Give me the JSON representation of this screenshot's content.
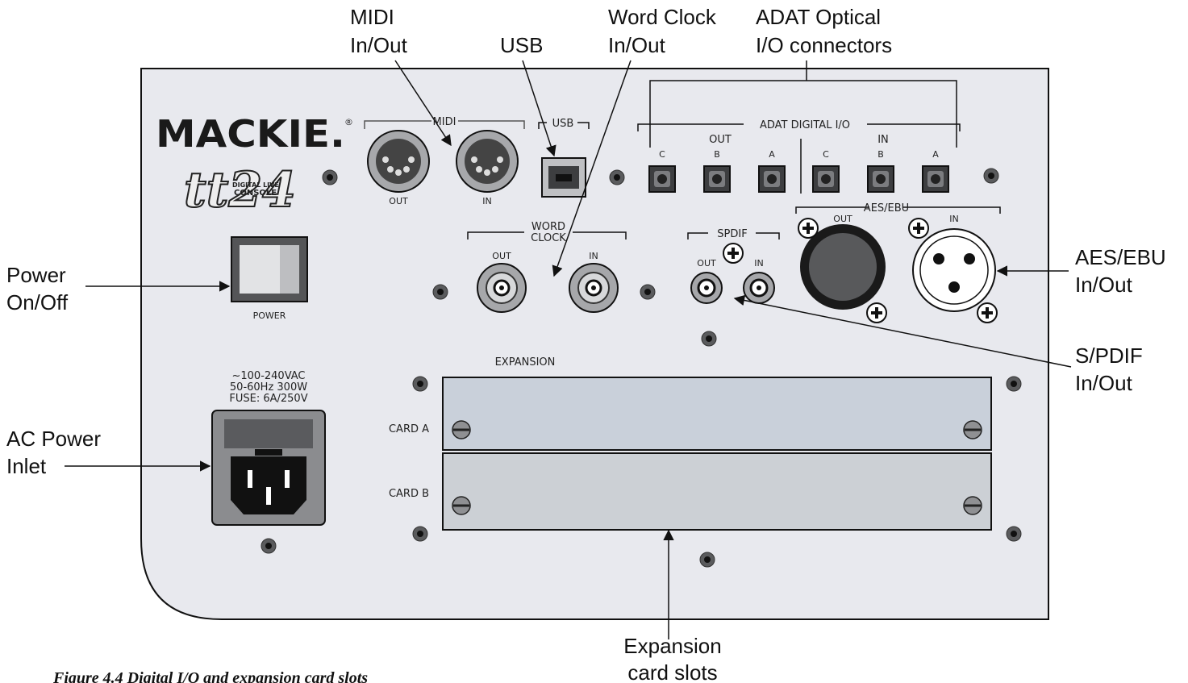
{
  "brand": {
    "name": "MACKIE.",
    "registered": "®",
    "model": "tt24",
    "model_sub_line1": "DIGITAL LIVE",
    "model_sub_line2": "CONSOLE"
  },
  "panel": {
    "midi": {
      "section": "MIDI",
      "out": "OUT",
      "in": "IN"
    },
    "usb": {
      "section": "USB"
    },
    "adat": {
      "section": "ADAT DIGITAL I/O",
      "out_group": "OUT",
      "in_group": "IN",
      "out_ports": [
        "C",
        "B",
        "A"
      ],
      "in_ports": [
        "C",
        "B",
        "A"
      ]
    },
    "word_clock": {
      "line1": "WORD",
      "line2": "CLOCK",
      "out": "OUT",
      "in": "IN"
    },
    "spdif": {
      "section": "SPDIF",
      "out": "OUT",
      "in": "IN"
    },
    "aes": {
      "section": "AES/EBU",
      "out": "OUT",
      "in": "IN"
    },
    "power": {
      "label": "POWER"
    },
    "ac_rating": {
      "line1": "~100-240VAC",
      "line2": "50-60Hz 300W",
      "line3": "FUSE: 6A/250V"
    },
    "expansion": {
      "section": "EXPANSION",
      "card_a": "CARD A",
      "card_b": "CARD B"
    }
  },
  "callouts": {
    "midi": {
      "line1": "MIDI",
      "line2": "In/Out"
    },
    "usb": {
      "line1": "USB"
    },
    "word_clock": {
      "line1": "Word Clock",
      "line2": "In/Out"
    },
    "adat": {
      "line1": "ADAT Optical",
      "line2": "I/O connectors"
    },
    "power": {
      "line1": "Power",
      "line2": "On/Off"
    },
    "ac": {
      "line1": "AC Power",
      "line2": "Inlet"
    },
    "aes": {
      "line1": "AES/EBU",
      "line2": "In/Out"
    },
    "spdif": {
      "line1": "S/PDIF",
      "line2": "In/Out"
    },
    "expansion": {
      "line1": "Expansion",
      "line2": "card slots"
    }
  },
  "caption": "Figure 4.4 Digital I/O and expansion card slots",
  "colors": {
    "panel": "#e8e9ee",
    "card": "#c9d0da",
    "port": "#58595b",
    "outline": "#111111"
  }
}
